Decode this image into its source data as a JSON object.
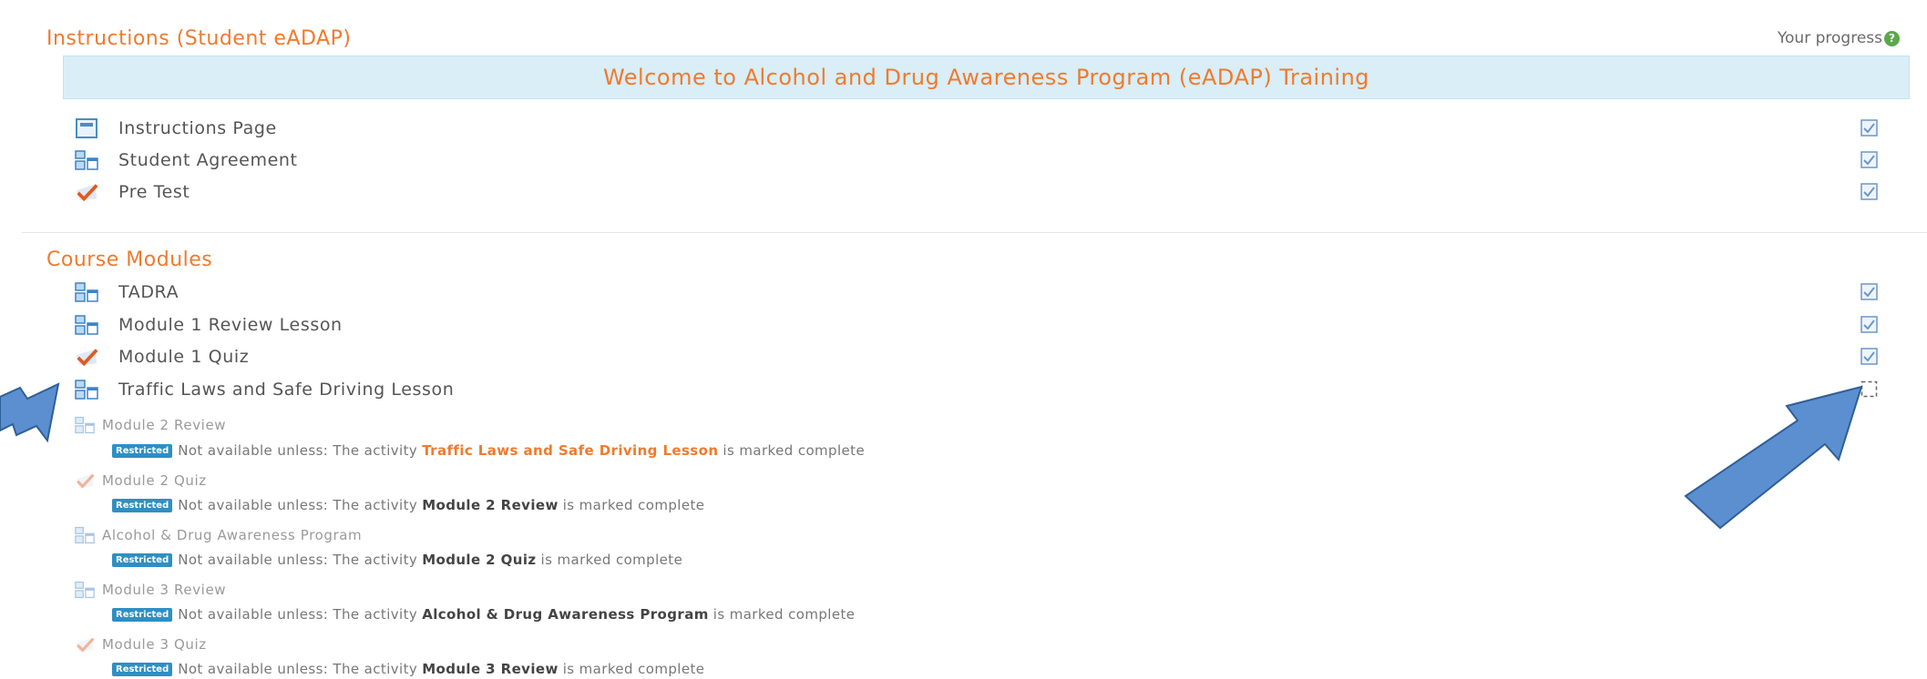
{
  "section1": {
    "title": "Instructions (Student eADAP)",
    "progress_label": "Your progress"
  },
  "banner": {
    "text": "Welcome to Alcohol and Drug Awareness Program (eADAP) Training"
  },
  "instructions_items": [
    {
      "name": "Instructions Page",
      "icon": "page-icon",
      "complete": true
    },
    {
      "name": "Student Agreement",
      "icon": "lesson-icon",
      "complete": true
    },
    {
      "name": "Pre Test",
      "icon": "quiz-icon",
      "complete": true
    }
  ],
  "section2": {
    "title": "Course Modules"
  },
  "module_items": [
    {
      "name": "TADRA",
      "icon": "lesson-icon",
      "complete": true
    },
    {
      "name": "Module 1 Review Lesson",
      "icon": "lesson-icon",
      "complete": true
    },
    {
      "name": "Module 1 Quiz",
      "icon": "quiz-icon",
      "complete": true
    },
    {
      "name": "Traffic Laws and Safe Driving Lesson",
      "icon": "lesson-icon",
      "complete": false
    }
  ],
  "restricted_items": [
    {
      "name": "Module 2 Review",
      "icon": "lesson-icon",
      "badge": "Restricted",
      "prefix": "Not available unless: The activity",
      "activity": "Traffic Laws and Safe Driving Lesson",
      "suffix": "is marked complete"
    },
    {
      "name": "Module 2 Quiz",
      "icon": "quiz-icon",
      "badge": "Restricted",
      "prefix": "Not available unless: The activity",
      "activity": "Module 2 Review",
      "suffix": "is marked complete"
    },
    {
      "name": "Alcohol & Drug Awareness Program",
      "icon": "lesson-icon",
      "badge": "Restricted",
      "prefix": "Not available unless: The activity",
      "activity": "Module 2 Quiz",
      "suffix": "is marked complete"
    },
    {
      "name": "Module 3 Review",
      "icon": "lesson-icon",
      "badge": "Restricted",
      "prefix": "Not available unless: The activity",
      "activity": "Alcohol & Drug Awareness Program",
      "suffix": "is marked complete"
    },
    {
      "name": "Module 3 Quiz",
      "icon": "quiz-icon",
      "badge": "Restricted",
      "prefix": "Not available unless: The activity",
      "activity": "Module 3 Review",
      "suffix": "is marked complete"
    }
  ],
  "colors": {
    "accent": "#f07a2d",
    "banner_bg": "#d9eef7",
    "badge_bg": "#2e8fc4",
    "arrow": "#5b8fd0"
  }
}
